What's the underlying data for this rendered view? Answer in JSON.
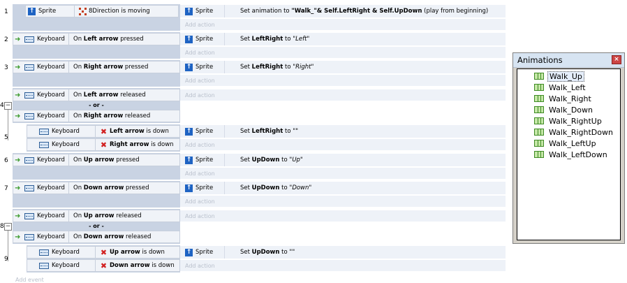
{
  "events": [
    {
      "num": "1",
      "conditions": [
        {
          "object": "Sprite",
          "icon": "sprite",
          "pre": "",
          "bold": "",
          "post": "8Direction is moving",
          "type": "8dir"
        }
      ],
      "action": {
        "object": "Sprite",
        "pre": "Set animation to ",
        "bold": "\"Walk_\"& Self.LeftRight & Self.UpDown",
        "post": " (play from beginning)"
      }
    },
    {
      "num": "2",
      "conditions": [
        {
          "object": "Keyboard",
          "pre": "On ",
          "bold": "Left arrow",
          "post": " pressed"
        }
      ],
      "action": {
        "object": "Sprite",
        "pre": "Set ",
        "bold": "LeftRight",
        "post": " to ",
        "ital": "\"Left\""
      }
    },
    {
      "num": "3",
      "conditions": [
        {
          "object": "Keyboard",
          "pre": "On ",
          "bold": "Right arrow",
          "post": " pressed"
        }
      ],
      "action": {
        "object": "Sprite",
        "pre": "Set ",
        "bold": "LeftRight",
        "post": " to ",
        "ital": "\"Right\""
      }
    },
    {
      "num": "4",
      "conditions": [
        {
          "object": "Keyboard",
          "pre": "On ",
          "bold": "Left arrow",
          "post": " released"
        },
        {
          "object": "Keyboard",
          "pre": "On ",
          "bold": "Right arrow",
          "post": " released"
        }
      ],
      "or_label": "- or -"
    },
    {
      "num": "5",
      "conditions": [
        {
          "object": "Keyboard",
          "bold": "Left arrow",
          "post": " is down"
        },
        {
          "object": "Keyboard",
          "bold": "Right arrow",
          "post": " is down"
        }
      ],
      "action": {
        "object": "Sprite",
        "pre": "Set ",
        "bold": "LeftRight",
        "post": " to ",
        "ital": "\"\""
      }
    },
    {
      "num": "6",
      "conditions": [
        {
          "object": "Keyboard",
          "pre": "On ",
          "bold": "Up arrow",
          "post": " pressed"
        }
      ],
      "action": {
        "object": "Sprite",
        "pre": "Set ",
        "bold": "UpDown",
        "post": " to ",
        "ital": "\"Up\""
      }
    },
    {
      "num": "7",
      "conditions": [
        {
          "object": "Keyboard",
          "pre": "On ",
          "bold": "Down arrow",
          "post": " pressed"
        }
      ],
      "action": {
        "object": "Sprite",
        "pre": "Set ",
        "bold": "UpDown",
        "post": " to ",
        "ital": "\"Down\""
      }
    },
    {
      "num": "8",
      "conditions": [
        {
          "object": "Keyboard",
          "pre": "On ",
          "bold": "Up arrow",
          "post": " released"
        },
        {
          "object": "Keyboard",
          "pre": "On ",
          "bold": "Down arrow",
          "post": " released"
        }
      ],
      "or_label": "- or -"
    },
    {
      "num": "9",
      "conditions": [
        {
          "object": "Keyboard",
          "bold": "Up arrow",
          "post": " is down"
        },
        {
          "object": "Keyboard",
          "bold": "Down arrow",
          "post": " is down"
        }
      ],
      "action": {
        "object": "Sprite",
        "pre": "Set ",
        "bold": "UpDown",
        "post": " to ",
        "ital": "\"\""
      }
    }
  ],
  "add_action_label": "Add action",
  "add_event_label": "Add event",
  "collapse_symbol": "−",
  "panel": {
    "title": "Animations",
    "close_symbol": "×",
    "selected": "Walk_Up",
    "items": [
      "Walk_Up",
      "Walk_Left",
      "Walk_Right",
      "Walk_Down",
      "Walk_RightUp",
      "Walk_RightDown",
      "Walk_LeftUp",
      "Walk_LeftDown"
    ]
  },
  "colors": {
    "sprite_icon": "#1e63c3",
    "trigger_arrow": "#3c9b2d",
    "invert_x": "#d12020",
    "film_icon": "#c6e8a8"
  }
}
